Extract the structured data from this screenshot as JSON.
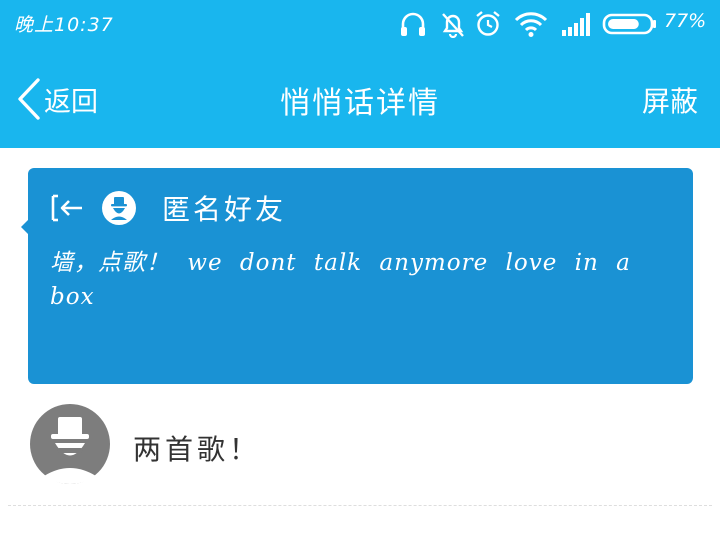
{
  "status_bar": {
    "time": "晚上10:37",
    "battery_percent": "77%",
    "battery_level": 0.77,
    "icons": [
      "headset-icon",
      "notifications-off-icon",
      "alarm-icon",
      "wifi-icon",
      "signal-icon",
      "battery-icon"
    ]
  },
  "nav": {
    "back_label": "返回",
    "title": "悄悄话详情",
    "block_label": "屏蔽"
  },
  "whisper": {
    "sender": "匿名好友",
    "message": "墙，点歌！ we dont talk anymore love in a box"
  },
  "reply": {
    "text": "两首歌！"
  },
  "colors": {
    "header_bg": "#19b6ee",
    "card_bg": "#1a92d4",
    "avatar_bg": "#7d7d7d",
    "text_dark": "#333333",
    "white": "#ffffff"
  }
}
